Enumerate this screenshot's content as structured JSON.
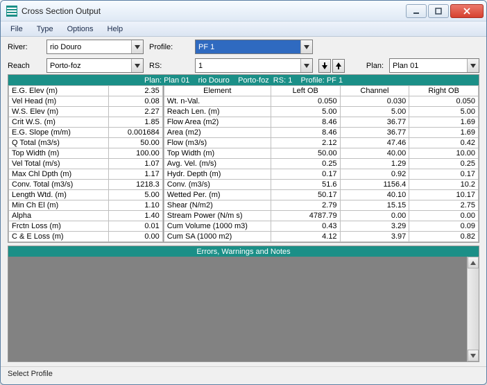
{
  "window": {
    "title": "Cross Section Output"
  },
  "menu": {
    "file": "File",
    "type": "Type",
    "options": "Options",
    "help": "Help"
  },
  "toolbar": {
    "river_label": "River:",
    "river_value": "rio Douro",
    "profile_label": "Profile:",
    "profile_value": "PF 1",
    "reach_label": "Reach",
    "reach_value": "Porto-foz",
    "rs_label": "RS:",
    "rs_value": "1",
    "plan_label": "Plan:",
    "plan_value": "Plan 01"
  },
  "banner": "Plan: Plan 01    rio Douro    Porto-foz  RS: 1    Profile: PF 1",
  "left_table": [
    {
      "label": "E.G. Elev (m)",
      "value": "2.35"
    },
    {
      "label": "Vel Head (m)",
      "value": "0.08"
    },
    {
      "label": "W.S. Elev (m)",
      "value": "2.27"
    },
    {
      "label": "Crit W.S. (m)",
      "value": "1.85"
    },
    {
      "label": "E.G. Slope (m/m)",
      "value": "0.001684"
    },
    {
      "label": "Q Total (m3/s)",
      "value": "50.00"
    },
    {
      "label": "Top Width (m)",
      "value": "100.00"
    },
    {
      "label": "Vel Total (m/s)",
      "value": "1.07"
    },
    {
      "label": "Max Chl Dpth (m)",
      "value": "1.17"
    },
    {
      "label": "Conv. Total (m3/s)",
      "value": "1218.3"
    },
    {
      "label": "Length Wtd. (m)",
      "value": "5.00"
    },
    {
      "label": "Min Ch El (m)",
      "value": "1.10"
    },
    {
      "label": "Alpha",
      "value": "1.40"
    },
    {
      "label": "Frctn Loss (m)",
      "value": "0.01"
    },
    {
      "label": "C & E Loss (m)",
      "value": "0.00"
    }
  ],
  "right_header": {
    "element": "Element",
    "lob": "Left OB",
    "chan": "Channel",
    "rob": "Right OB"
  },
  "right_table": [
    {
      "label": "Wt. n-Val.",
      "lob": "0.050",
      "chan": "0.030",
      "rob": "0.050"
    },
    {
      "label": "Reach Len. (m)",
      "lob": "5.00",
      "chan": "5.00",
      "rob": "5.00"
    },
    {
      "label": "Flow Area (m2)",
      "lob": "8.46",
      "chan": "36.77",
      "rob": "1.69"
    },
    {
      "label": "Area (m2)",
      "lob": "8.46",
      "chan": "36.77",
      "rob": "1.69"
    },
    {
      "label": "Flow (m3/s)",
      "lob": "2.12",
      "chan": "47.46",
      "rob": "0.42"
    },
    {
      "label": "Top Width (m)",
      "lob": "50.00",
      "chan": "40.00",
      "rob": "10.00"
    },
    {
      "label": "Avg. Vel. (m/s)",
      "lob": "0.25",
      "chan": "1.29",
      "rob": "0.25"
    },
    {
      "label": "Hydr. Depth (m)",
      "lob": "0.17",
      "chan": "0.92",
      "rob": "0.17"
    },
    {
      "label": "Conv. (m3/s)",
      "lob": "51.6",
      "chan": "1156.4",
      "rob": "10.2"
    },
    {
      "label": "Wetted Per. (m)",
      "lob": "50.17",
      "chan": "40.10",
      "rob": "10.17"
    },
    {
      "label": "Shear (N/m2)",
      "lob": "2.79",
      "chan": "15.15",
      "rob": "2.75"
    },
    {
      "label": "Stream Power (N/m s)",
      "lob": "4787.79",
      "chan": "0.00",
      "rob": "0.00"
    },
    {
      "label": "Cum Volume (1000 m3)",
      "lob": "0.43",
      "chan": "3.29",
      "rob": "0.09"
    },
    {
      "label": "Cum SA (1000 m2)",
      "lob": "4.12",
      "chan": "3.97",
      "rob": "0.82"
    }
  ],
  "banner2": "Errors, Warnings and Notes",
  "status": "Select Profile"
}
